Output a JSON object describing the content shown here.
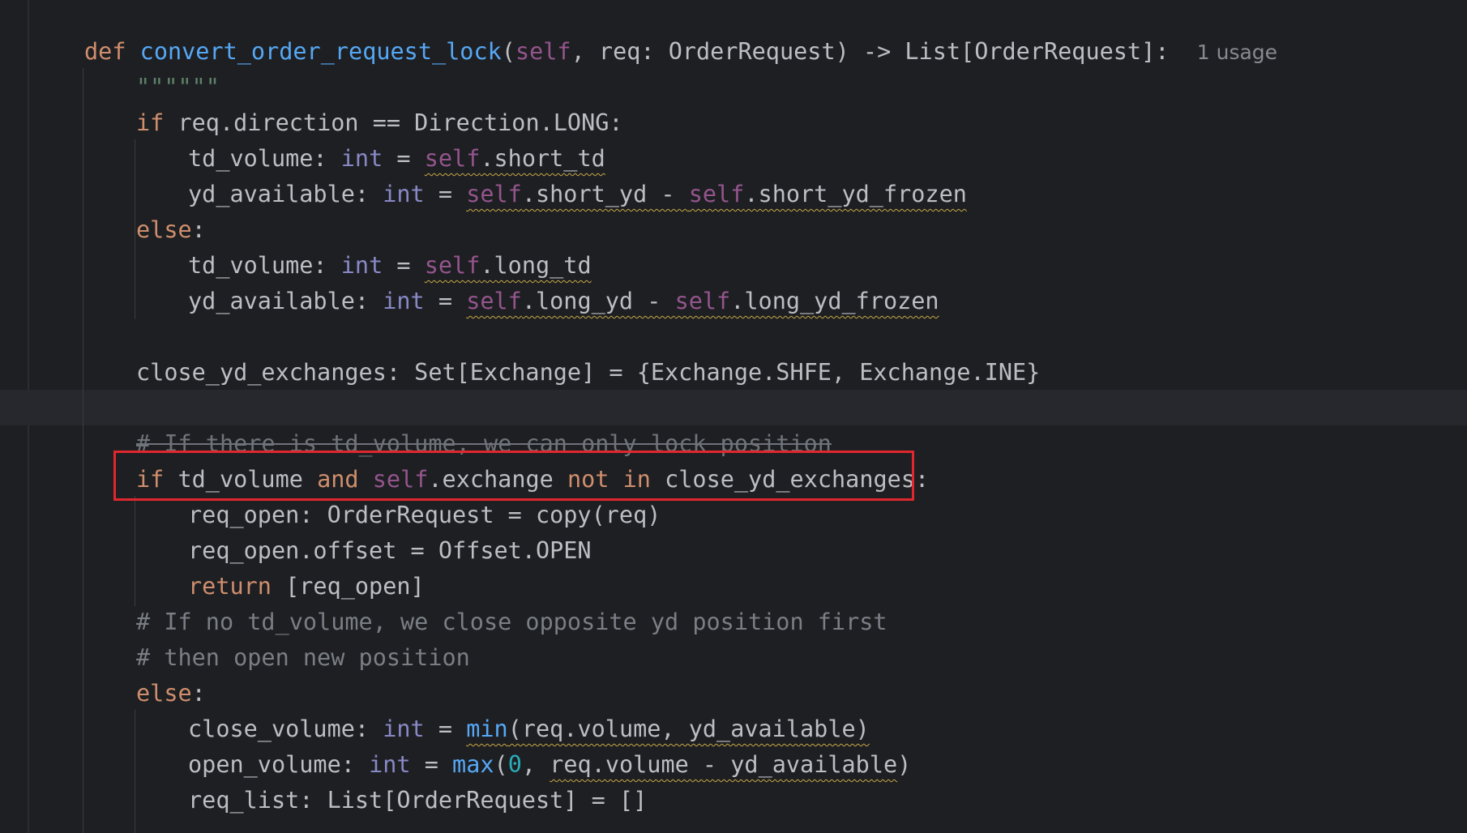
{
  "editor": {
    "usage_hint": "1 usage",
    "lines": {
      "def_kw": "def",
      "def_name": "convert_order_request_lock",
      "def_open": "(",
      "def_self": "self",
      "def_rest": ", req: OrderRequest) -> List[OrderRequest]:",
      "docstring": "\"\"\"\"\"\"",
      "if1_kw": "if",
      "if1_rest": " req.direction == Direction.LONG:",
      "l3_a": "td_volume: ",
      "l3_type": "int",
      "l3_eq": " = ",
      "l3_self": "self",
      "l3_attr": ".short_td",
      "l4_a": "yd_available: ",
      "l4_type": "int",
      "l4_eq": " = ",
      "l4_self1": "self",
      "l4_mid": ".short_yd - ",
      "l4_self2": "self",
      "l4_end": ".short_yd_frozen",
      "else1": "else",
      "colon": ":",
      "l6_a": "td_volume: ",
      "l6_type": "int",
      "l6_eq": " = ",
      "l6_self": "self",
      "l6_attr": ".long_td",
      "l7_a": "yd_available: ",
      "l7_type": "int",
      "l7_eq": " = ",
      "l7_self1": "self",
      "l7_mid": ".long_yd - ",
      "l7_self2": "self",
      "l7_end": ".long_yd_frozen",
      "close_ex": "close_yd_exchanges: Set[Exchange] = {Exchange.SHFE, Exchange.INE}",
      "comment1": "# If there is td_volume, we can only lock position",
      "if2_kw": "if",
      "if2_a": " td_volume ",
      "if2_and": "and",
      "if2_sp": " ",
      "if2_self": "self",
      "if2_b": ".exchange ",
      "if2_not": "not",
      "if2_sp2": " ",
      "if2_in": "in",
      "if2_c": " close_yd_exchanges:",
      "req_open": "req_open: OrderRequest = copy(req)",
      "req_offset": "req_open.offset = Offset.OPEN",
      "return_kw": "return",
      "return_rest": " [req_open]",
      "comment2": "# If no td_volume, we close opposite yd position first",
      "comment3": "# then open new position",
      "else2": "else",
      "cv_a": "close_volume: ",
      "cv_type": "int",
      "cv_eq": " = ",
      "cv_fn": "min",
      "cv_args": "(req.volume, yd_available)",
      "ov_a": "open_volume: ",
      "ov_type": "int",
      "ov_eq": " = ",
      "ov_fn": "max",
      "ov_p": "(",
      "ov_num": "0",
      "ov_comma": ", ",
      "ov_args": "req.volume - yd_available",
      "ov_close": ")",
      "req_list": "req_list: List[OrderRequest] = []"
    }
  },
  "colors": {
    "background": "#1e1f22",
    "keyword": "#cf8e6d",
    "function": "#56a8f5",
    "self": "#94558d",
    "builtin_type": "#8888c6",
    "comment": "#7a7e85",
    "highlight_border": "#e0272d"
  }
}
